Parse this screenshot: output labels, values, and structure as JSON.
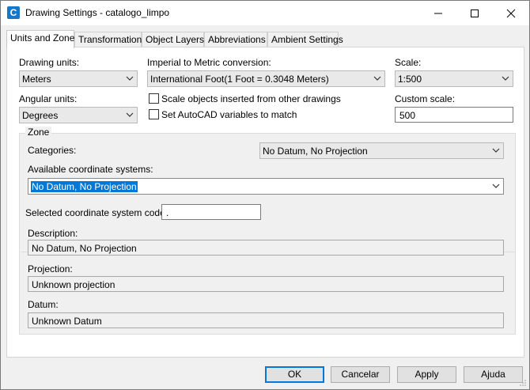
{
  "window": {
    "title": "Drawing Settings - catalogo_limpo"
  },
  "tabs": [
    {
      "label": "Units and Zone",
      "active": true
    },
    {
      "label": "Transformation",
      "active": false
    },
    {
      "label": "Object Layers",
      "active": false
    },
    {
      "label": "Abbreviations",
      "active": false
    },
    {
      "label": "Ambient Settings",
      "active": false
    }
  ],
  "units": {
    "drawing_units_label": "Drawing units:",
    "drawing_units_value": "Meters",
    "angular_units_label": "Angular units:",
    "angular_units_value": "Degrees",
    "imperial_label": "Imperial to Metric conversion:",
    "imperial_value": "International Foot(1 Foot = 0.3048 Meters)",
    "scale_objects_label": "Scale objects inserted from other drawings",
    "set_autocad_label": "Set AutoCAD variables to match",
    "scale_label": "Scale:",
    "scale_value": "1:500",
    "custom_scale_label": "Custom scale:",
    "custom_scale_value": "500"
  },
  "zone": {
    "title": "Zone",
    "categories_label": "Categories:",
    "categories_value": "No Datum, No Projection",
    "available_label": "Available coordinate systems:",
    "available_value": "No Datum, No Projection",
    "selected_code_label": "Selected coordinate system code:",
    "selected_code_value": ".",
    "description_label": "Description:",
    "description_value": "No Datum, No Projection",
    "projection_label": "Projection:",
    "projection_value": "Unknown projection",
    "datum_label": "Datum:",
    "datum_value": "Unknown Datum"
  },
  "buttons": {
    "ok": "OK",
    "cancel": "Cancelar",
    "apply": "Apply",
    "help": "Ajuda"
  },
  "colors": {
    "accent": "#0078d7",
    "app_icon": "#1877c9"
  }
}
